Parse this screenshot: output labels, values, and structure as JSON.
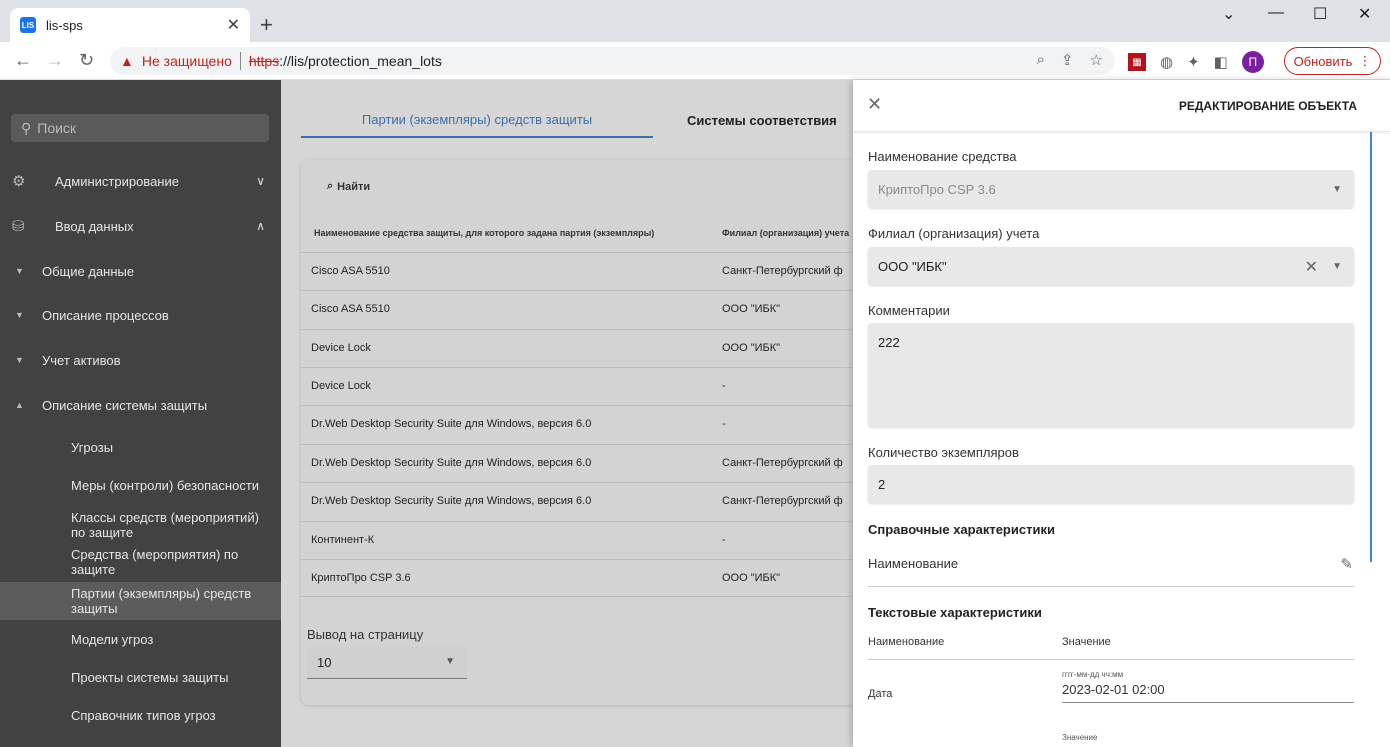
{
  "browser": {
    "tab_title": "lis-sps",
    "favicon_text": "LIS",
    "insecure_label": "Не защищено",
    "url_scheme": "https",
    "url_rest": "://lis/protection_mean_lots",
    "update_label": "Обновить",
    "profile_initial": "П"
  },
  "sidebar": {
    "search_placeholder": "Поиск",
    "items": [
      {
        "label": "Администрирование"
      },
      {
        "label": "Ввод данных"
      },
      {
        "label": "Общие данные"
      },
      {
        "label": "Описание процессов"
      },
      {
        "label": "Учет активов"
      },
      {
        "label": "Описание системы защиты"
      },
      {
        "label": "Угрозы"
      },
      {
        "label": "Меры (контроли) безопасности"
      },
      {
        "label": "Классы средств (мероприятий) по защите"
      },
      {
        "label": "Средства (мероприятия) по защите"
      },
      {
        "label": "Партии (экземпляры) средств защиты"
      },
      {
        "label": "Модели угроз"
      },
      {
        "label": "Проекты системы защиты"
      },
      {
        "label": "Справочник типов угроз"
      }
    ]
  },
  "main": {
    "tabs": [
      {
        "label": "Партии (экземпляры) средств защиты"
      },
      {
        "label": "Системы соответствия"
      }
    ],
    "find_label": "Найти",
    "columns": [
      "Наименование средства защиты, для которого задана партия (экземпляры)",
      "Филиал (организация) учета"
    ],
    "rows": [
      {
        "name": "Cisco ASA 5510",
        "branch": "Санкт-Петербургский ф"
      },
      {
        "name": "Cisco ASA 5510",
        "branch": "ООО \"ИБК\""
      },
      {
        "name": "Device Lock",
        "branch": "ООО \"ИБК\""
      },
      {
        "name": "Device Lock",
        "branch": "-"
      },
      {
        "name": "Dr.Web Desktop Security Suite для Windows, версия 6.0",
        "branch": "-"
      },
      {
        "name": "Dr.Web Desktop Security Suite для Windows, версия 6.0",
        "branch": "Санкт-Петербургский ф"
      },
      {
        "name": "Dr.Web Desktop Security Suite для Windows, версия 6.0",
        "branch": "Санкт-Петербургский ф"
      },
      {
        "name": "Континент-К",
        "branch": "-"
      },
      {
        "name": "КриптоПро CSP 3.6",
        "branch": "ООО \"ИБК\""
      }
    ],
    "per_page_label": "Вывод на страницу",
    "per_page_value": "10"
  },
  "panel": {
    "title": "РЕДАКТИРОВАНИЕ ОБЪЕКТА",
    "tool_label": "Наименование средства",
    "tool_value": "КриптоПро CSP 3.6",
    "branch_label": "Филиал (организация) учета",
    "branch_value": "ООО \"ИБК\"",
    "comments_label": "Комментарии",
    "comments_value": "222",
    "count_label": "Количество экземпляров",
    "count_value": "2",
    "ref_section": "Справочные характеристики",
    "ref_name_label": "Наименование",
    "text_section": "Текстовые характеристики",
    "text_col_name": "Наименование",
    "text_col_value": "Значение",
    "date_label": "Дата",
    "date_hint": "гггг-мм-дд чч:мм",
    "date_value": "2023-02-01 02:00",
    "value_hint": "Значение"
  }
}
